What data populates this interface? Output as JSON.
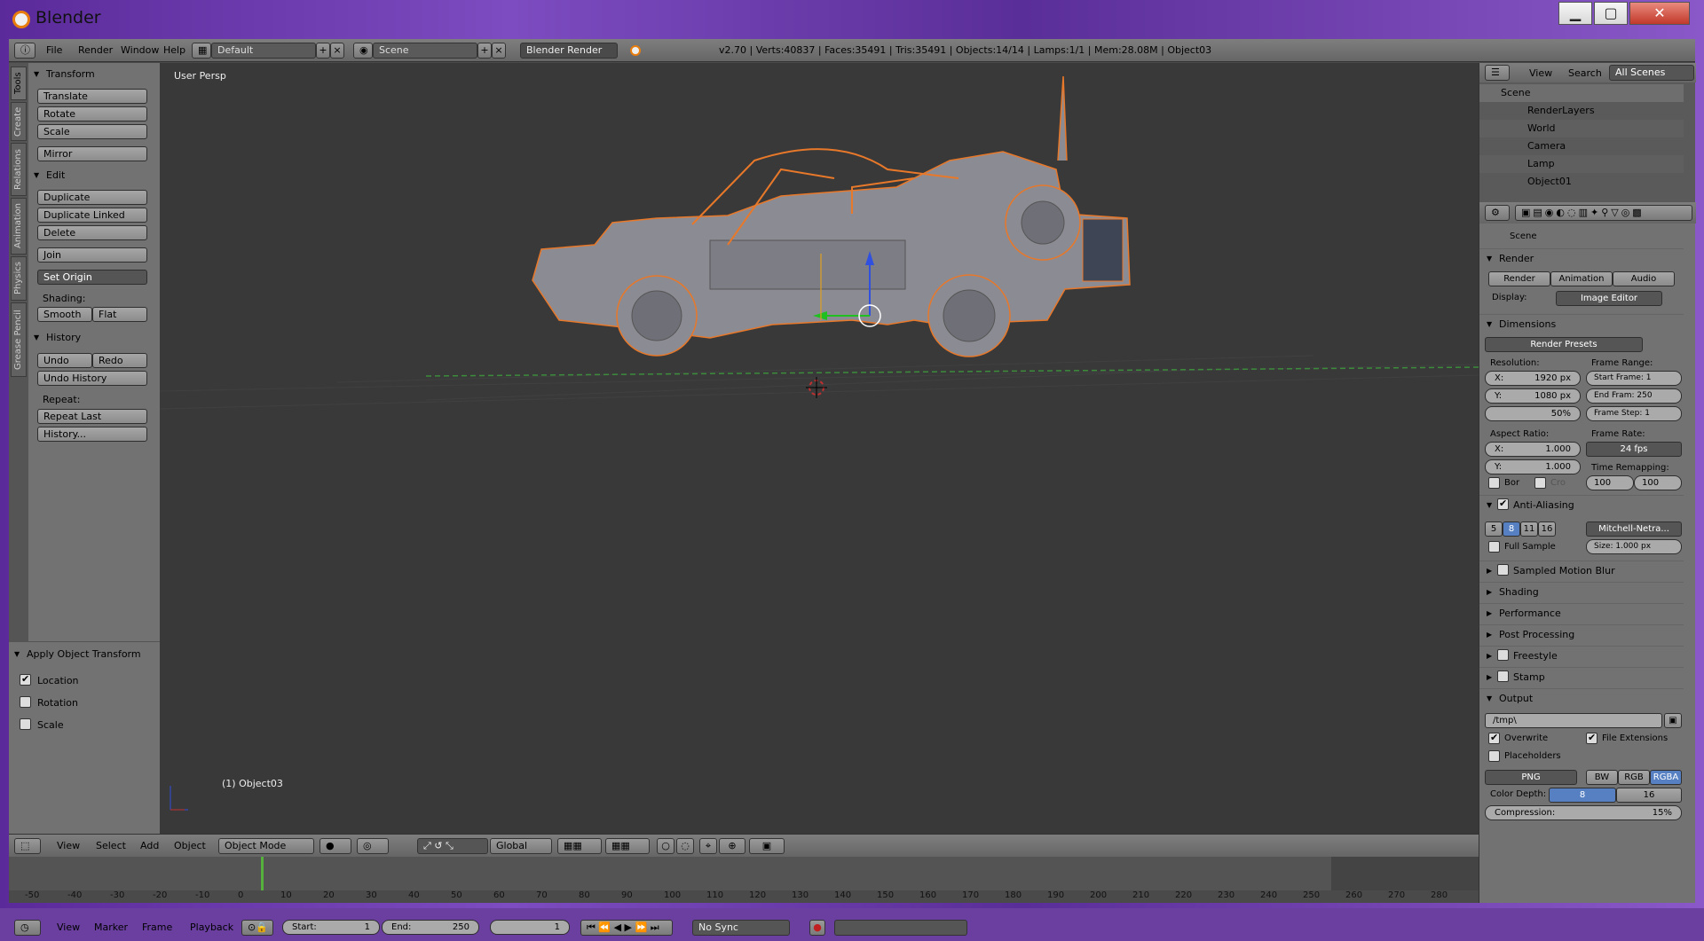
{
  "window": {
    "title": "Blender",
    "min_label": "▁",
    "max_label": "▢",
    "close_label": "✕"
  },
  "info": {
    "menus": [
      "File",
      "Render",
      "Window",
      "Help"
    ],
    "layout": "Default",
    "scene": "Scene",
    "engine": "Blender Render",
    "stats": "v2.70 | Verts:40837 | Faces:35491 | Tris:35491 | Objects:14/14 | Lamps:1/1 | Mem:28.08M | Object03"
  },
  "tabs": [
    "Tools",
    "Create",
    "Relations",
    "Animation",
    "Physics",
    "Grease Pencil"
  ],
  "shelf": {
    "transform": {
      "header": "Transform",
      "buttons": [
        "Translate",
        "Rotate",
        "Scale",
        "Mirror"
      ]
    },
    "edit": {
      "header": "Edit",
      "buttons": [
        "Duplicate",
        "Duplicate Linked",
        "Delete",
        "Join"
      ],
      "set_origin": "Set Origin",
      "shading_label": "Shading:",
      "smooth": "Smooth",
      "flat": "Flat"
    },
    "history": {
      "header": "History",
      "undo": "Undo",
      "redo": "Redo",
      "undo_history": "Undo History",
      "repeat_label": "Repeat:",
      "repeat_last": "Repeat Last",
      "history": "History..."
    }
  },
  "apply_op": {
    "header": "Apply Object Transform",
    "location": "Location",
    "rotation": "Rotation",
    "scale": "Scale",
    "location_checked": true,
    "rotation_checked": false,
    "scale_checked": false
  },
  "viewport": {
    "title": "User Persp",
    "object": "(1) Object03"
  },
  "view3d_header": {
    "menus": [
      "View",
      "Select",
      "Add",
      "Object"
    ],
    "mode": "Object Mode",
    "orientation": "Global"
  },
  "timeline": {
    "ticks": [
      "-50",
      "-40",
      "-30",
      "-20",
      "-10",
      "0",
      "10",
      "20",
      "30",
      "40",
      "50",
      "60",
      "70",
      "80",
      "90",
      "100",
      "110",
      "120",
      "130",
      "140",
      "150",
      "160",
      "170",
      "180",
      "190",
      "200",
      "210",
      "220",
      "230",
      "240",
      "250",
      "260",
      "270",
      "280"
    ],
    "current_frame": 0,
    "menus": [
      "View",
      "Marker",
      "Frame",
      "Playback"
    ],
    "start_label": "Start:",
    "start": "1",
    "end_label": "End:",
    "end": "250",
    "frame": "1",
    "sync": "No Sync"
  },
  "outliner": {
    "menus": [
      "View",
      "Search"
    ],
    "filter": "All Scenes",
    "rows": [
      "Scene",
      "RenderLayers",
      "World",
      "Camera",
      "Lamp",
      "Object01"
    ]
  },
  "props": {
    "context": "Scene",
    "render": {
      "header": "Render",
      "render_btn": "Render",
      "animation_btn": "Animation",
      "audio_btn": "Audio",
      "display_label": "Display:",
      "display": "Image Editor"
    },
    "dimensions": {
      "header": "Dimensions",
      "presets": "Render Presets",
      "resolution_label": "Resolution:",
      "res_x_label": "X:",
      "res_x": "1920 px",
      "res_y_label": "Y:",
      "res_y": "1080 px",
      "res_pct": "50%",
      "frame_range_label": "Frame Range:",
      "start_frame": "Start Frame: 1",
      "end_frame": "End Fram: 250",
      "frame_step": "Frame Step: 1",
      "aspect_label": "Aspect Ratio:",
      "asp_x_label": "X:",
      "asp_x": "1.000",
      "asp_y_label": "Y:",
      "asp_y": "1.000",
      "frame_rate_label": "Frame Rate:",
      "fps": "24 fps",
      "time_remap_label": "Time Remapping:",
      "remap_old": "100",
      "remap_new": "100",
      "border": "Bor",
      "crop": "Cro"
    },
    "aa": {
      "header": "Anti-Aliasing",
      "samples": [
        "5",
        "8",
        "11",
        "16"
      ],
      "selected": "8",
      "filter": "Mitchell-Netra...",
      "full_sample": "Full Sample",
      "size": "Size: 1.000 px"
    },
    "sections": [
      "Sampled Motion Blur",
      "Shading",
      "Performance",
      "Post Processing",
      "Freestyle",
      "Stamp"
    ],
    "output": {
      "header": "Output",
      "path": "/tmp\\",
      "overwrite": "Overwrite",
      "file_ext": "File Extensions",
      "placeholders": "Placeholders",
      "format": "PNG",
      "bw": "BW",
      "rgb": "RGB",
      "rgba": "RGBA",
      "color_depth_label": "Color Depth:",
      "depth8": "8",
      "depth16": "16",
      "compression": "Compression:",
      "compression_val": "15%"
    }
  }
}
